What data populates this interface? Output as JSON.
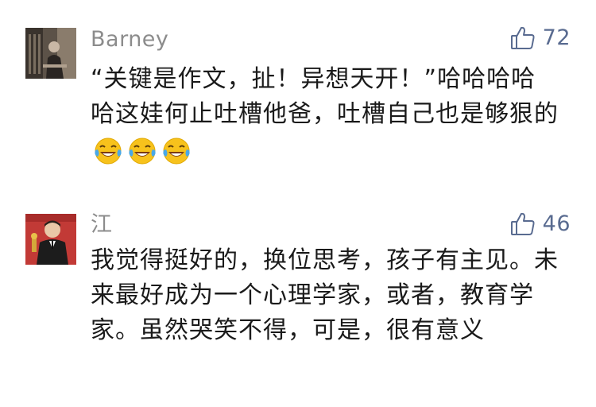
{
  "comments": [
    {
      "username": "Barney",
      "likes": "72",
      "text": "“关键是作文，扯！异想天开！”哈哈哈哈哈这娃何止吐槽他爸，吐槽自己也是够狠的",
      "emojis": [
        "laughing-tears-emoji",
        "laughing-tears-emoji",
        "laughing-tears-emoji"
      ]
    },
    {
      "username": "江",
      "likes": "46",
      "text": "我觉得挺好的，换位思考，孩子有主见。未来最好成为一个心理学家，或者，教育学家。虽然哭笑不得，可是，很有意义"
    }
  ],
  "icons": {
    "like": "thumbs-up-icon"
  },
  "colors": {
    "username": "#8c8c8c",
    "like_accent": "#596b90",
    "text": "#1a1a1a",
    "background": "#ffffff"
  }
}
